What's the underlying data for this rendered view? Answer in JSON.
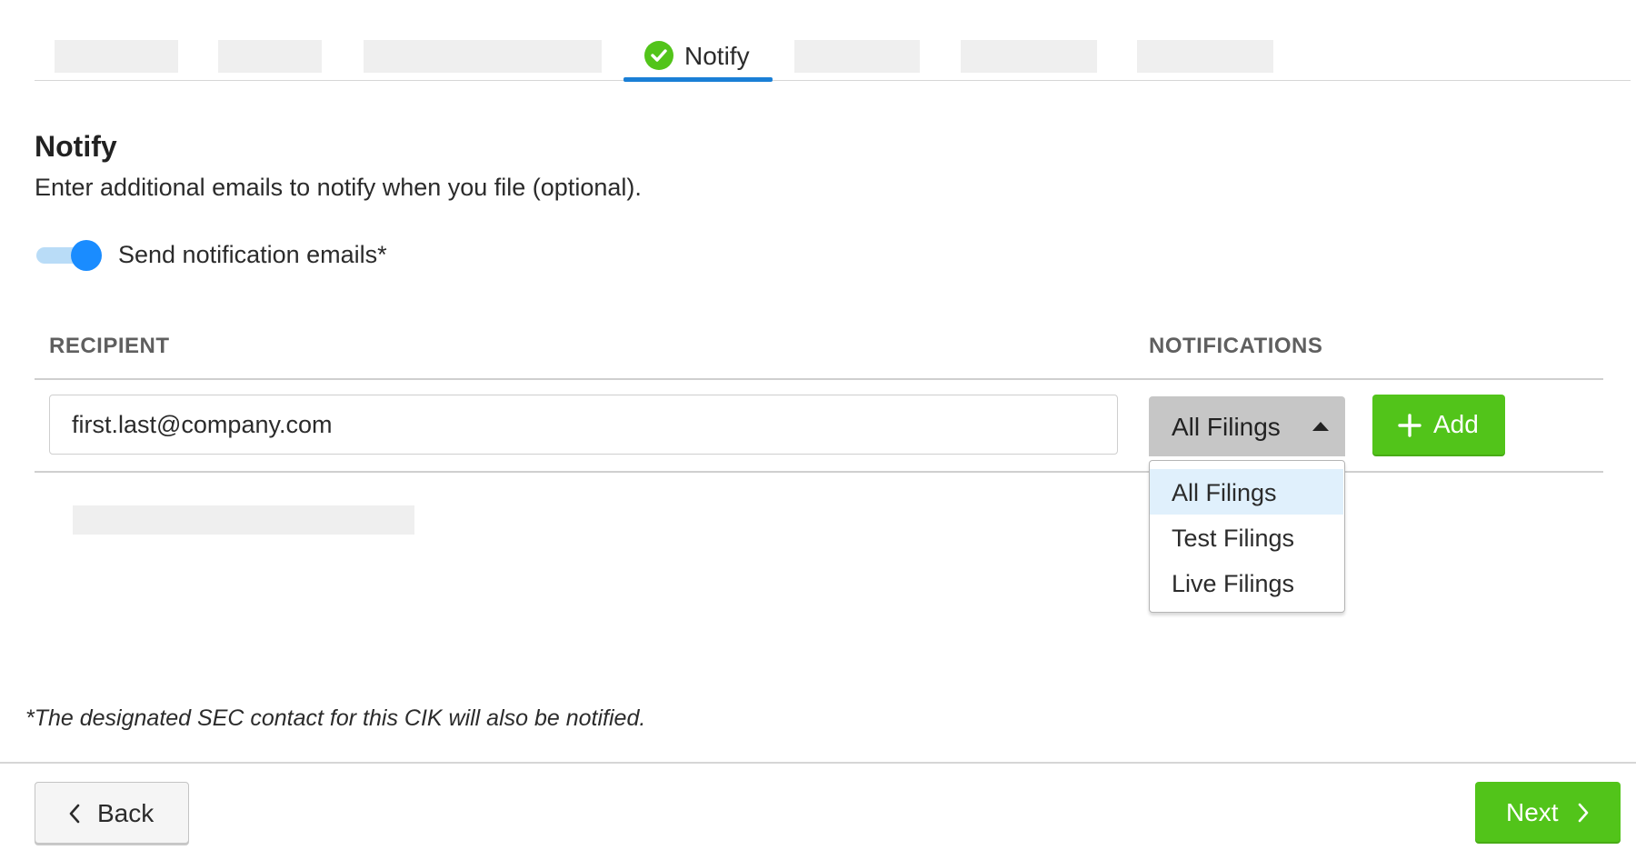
{
  "tabs": {
    "active_label": "Notify"
  },
  "header": {
    "title": "Notify",
    "subtitle": "Enter additional emails to notify when you file (optional)."
  },
  "toggle": {
    "label": "Send notification emails*",
    "on": true
  },
  "table": {
    "columns": [
      "RECIPIENT",
      "NOTIFICATIONS"
    ],
    "email_value": "first.last@company.com",
    "select_value": "All Filings",
    "options": [
      "All Filings",
      "Test Filings",
      "Live Filings"
    ],
    "selected_option": "All Filings",
    "add_label": "Add"
  },
  "footnote": "*The designated SEC contact for this CIK will also be notified.",
  "footer": {
    "back_label": "Back",
    "next_label": "Next"
  },
  "colors": {
    "accent_green": "#52c41a",
    "accent_blue": "#1a8cff",
    "tab_underline": "#1a7fd6"
  }
}
